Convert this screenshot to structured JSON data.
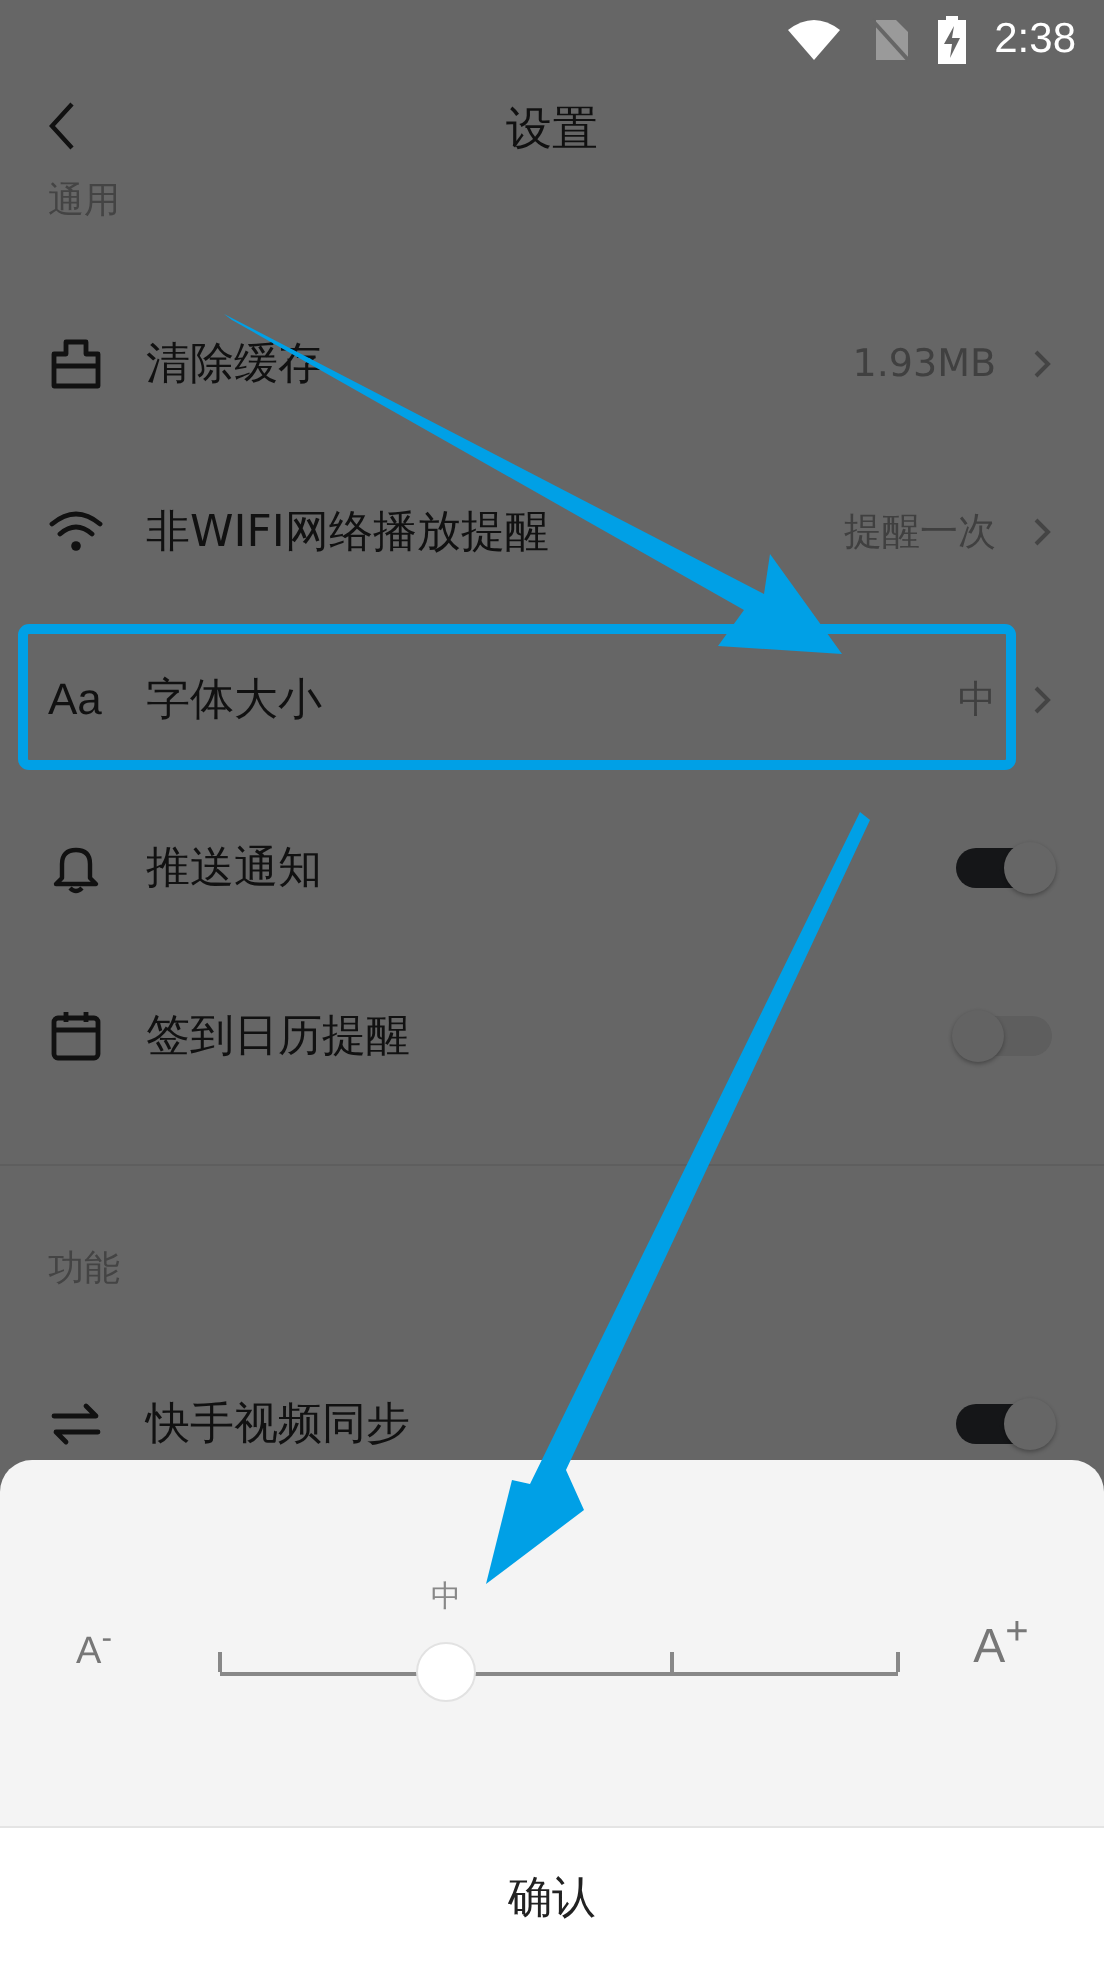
{
  "status_bar": {
    "time": "2:38"
  },
  "header": {
    "title": "设置"
  },
  "sections": [
    {
      "title": "通用",
      "items": [
        {
          "kind": "link",
          "label": "清除缓存",
          "value": "1.93MB"
        },
        {
          "kind": "link",
          "label": "非WIFI网络播放提醒",
          "value": "提醒一次"
        },
        {
          "kind": "link",
          "icon_text": "Aa",
          "label": "字体大小",
          "value": "中"
        },
        {
          "kind": "toggle",
          "label": "推送通知",
          "on": true
        },
        {
          "kind": "toggle",
          "label": "签到日历提醒",
          "on": false
        }
      ]
    },
    {
      "title": "功能",
      "items": [
        {
          "kind": "toggle",
          "label": "快手视频同步",
          "on": true
        }
      ]
    }
  ],
  "font_sheet": {
    "small_label": "A$^{-}$",
    "large_label": "A$^{+}$",
    "slider": {
      "value_label": "中",
      "level": 0.3333
    },
    "confirm": "确认"
  }
}
